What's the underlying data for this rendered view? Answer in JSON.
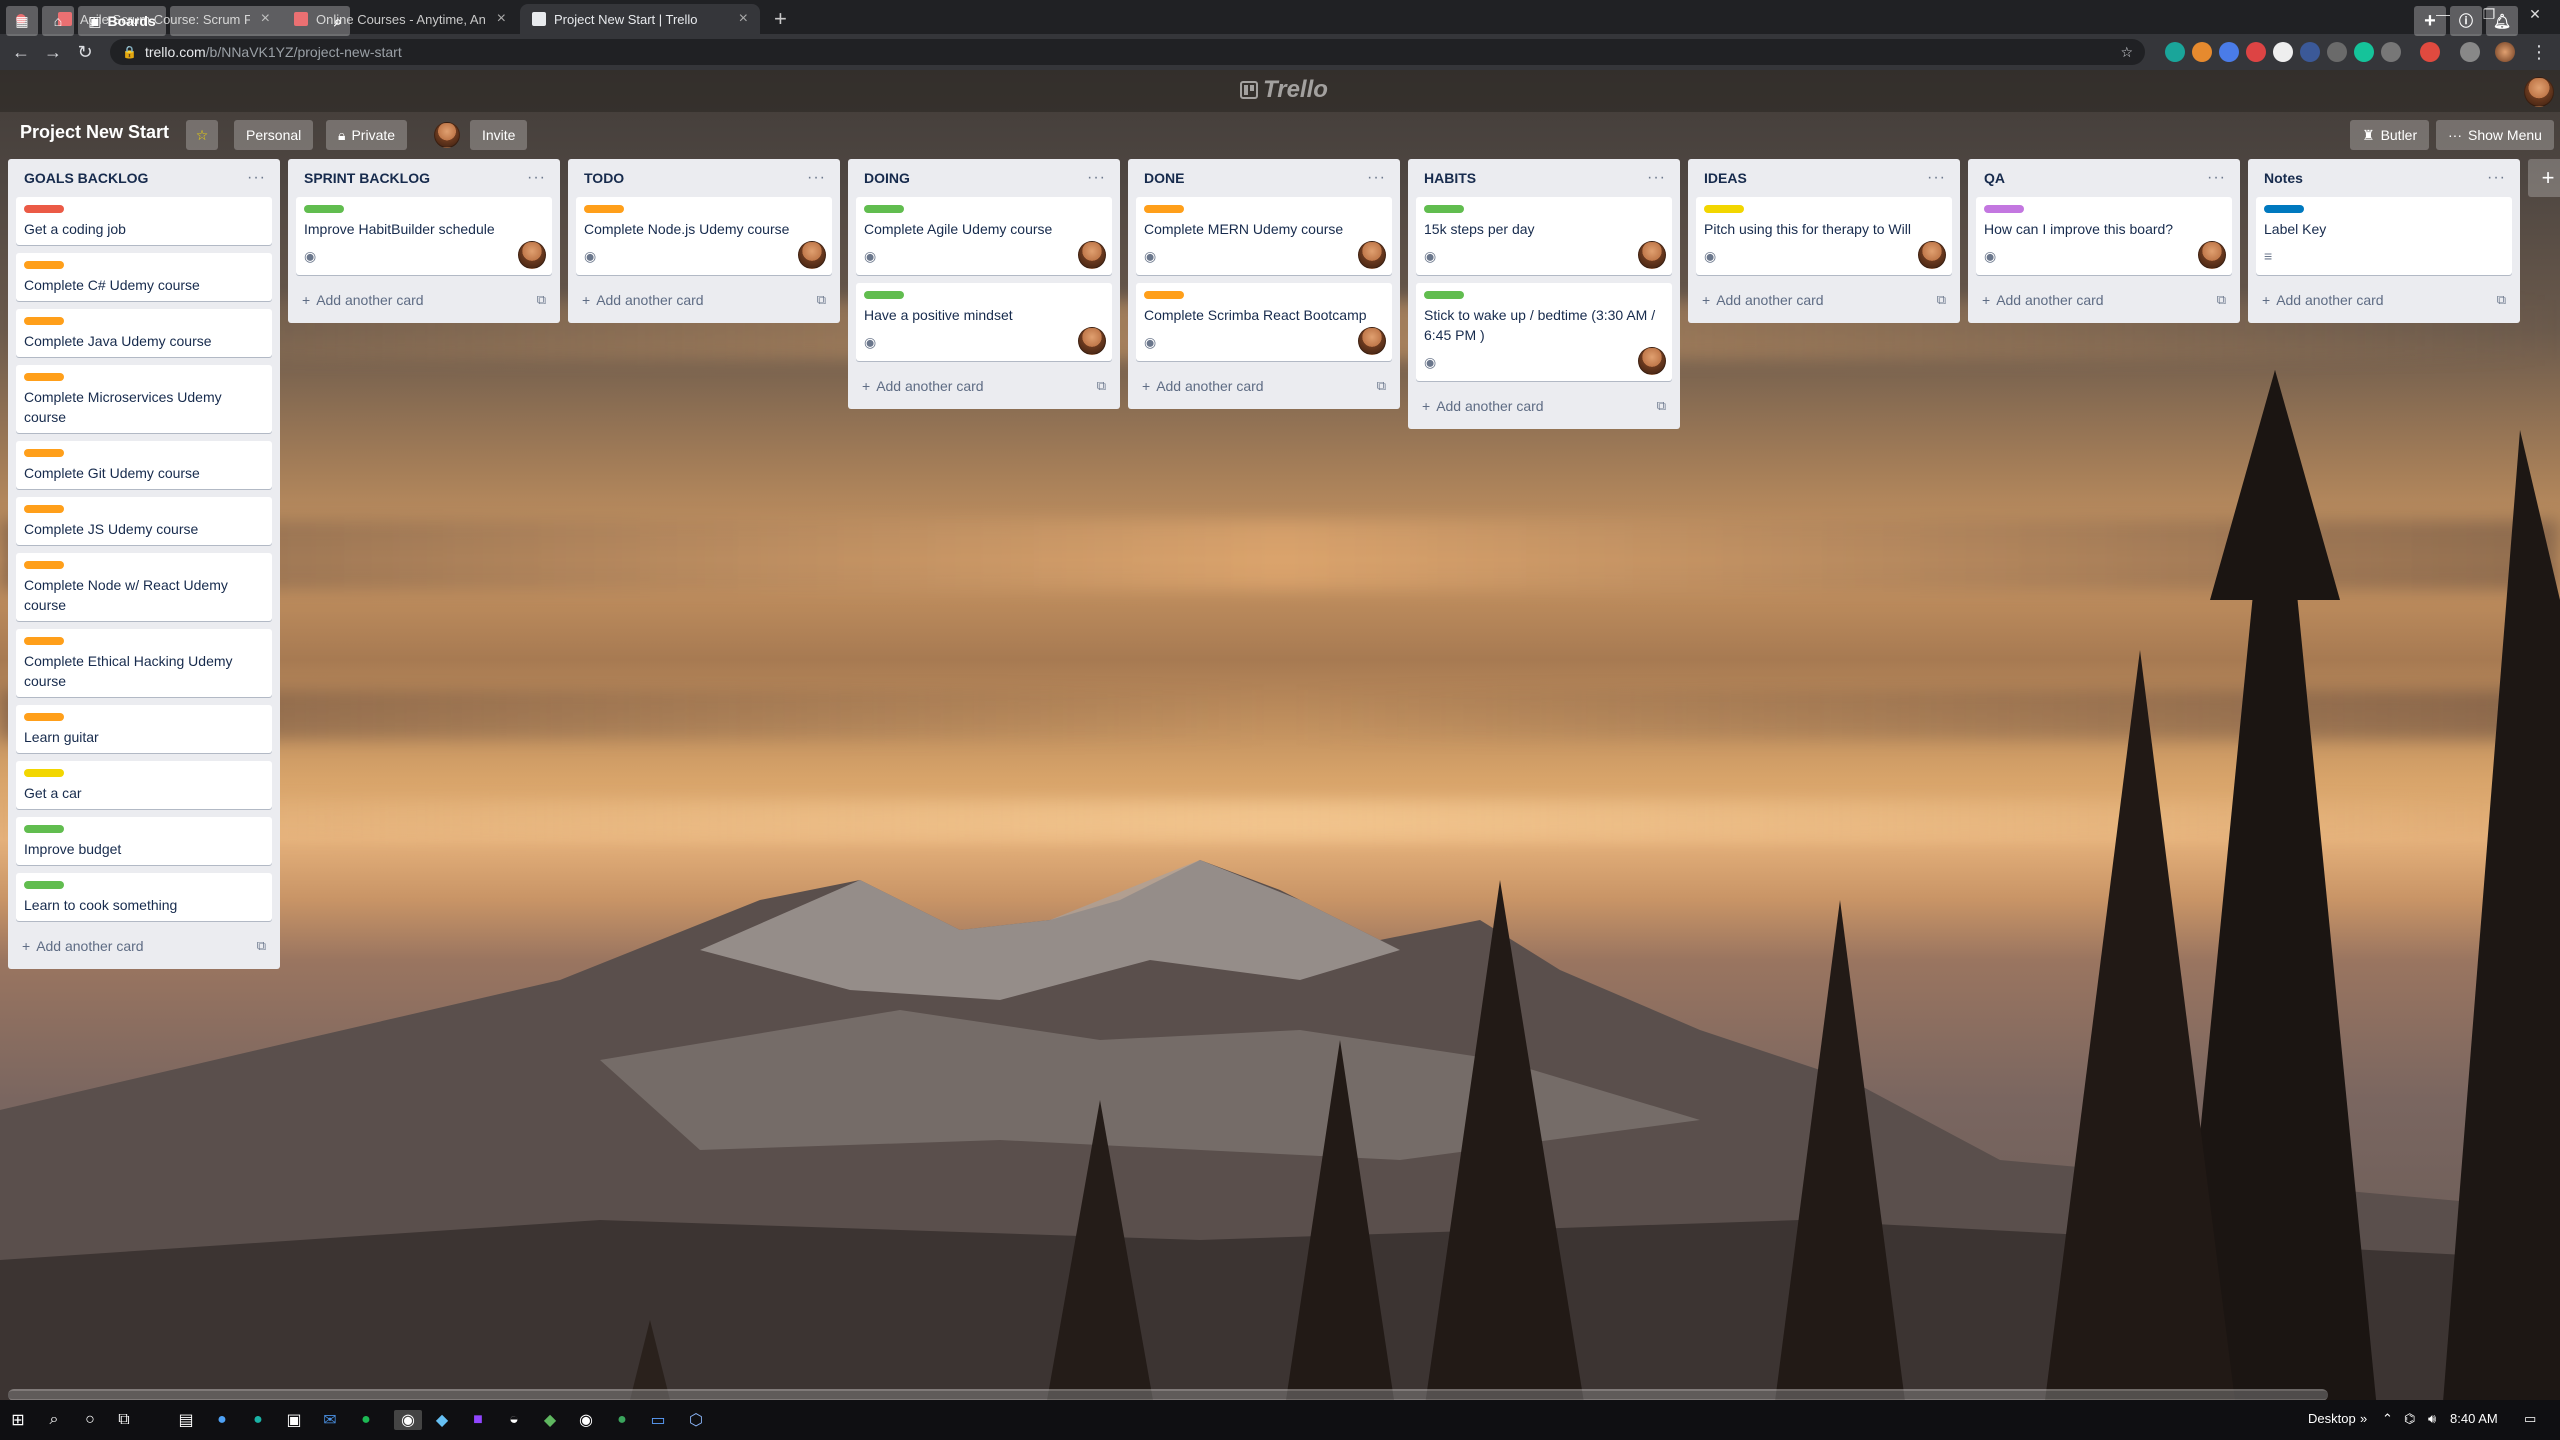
{
  "browser": {
    "tabs": [
      {
        "title": "Agile Scrum Course: Scrum Fund",
        "favicon_color": "#e4393c"
      },
      {
        "title": "Online Courses - Anytime, Anyw",
        "favicon_color": "#e4393c"
      },
      {
        "title": "Project New Start | Trello",
        "favicon_color": "#e8eaed"
      }
    ],
    "url_domain": "trello.com",
    "url_path": "/b/NNaVK1YZ/project-new-start"
  },
  "header": {
    "boards_label": "Boards",
    "logo_text": "Trello"
  },
  "board": {
    "title": "Project New Start",
    "personal_label": "Personal",
    "private_label": "Private",
    "invite_label": "Invite",
    "butler_label": "Butler",
    "show_menu_label": "Show Menu",
    "add_card_label": "Add another card"
  },
  "lists": [
    {
      "title": "GOALS BACKLOG",
      "cards": [
        {
          "text": "Get a coding job",
          "label": "#eb5a46"
        },
        {
          "text": "Complete C# Udemy course",
          "label": "#ff9f1a"
        },
        {
          "text": "Complete Java Udemy course",
          "label": "#ff9f1a"
        },
        {
          "text": "Complete Microservices Udemy course",
          "label": "#ff9f1a"
        },
        {
          "text": "Complete Git Udemy course",
          "label": "#ff9f1a"
        },
        {
          "text": "Complete JS Udemy course",
          "label": "#ff9f1a"
        },
        {
          "text": "Complete Node w/ React Udemy course",
          "label": "#ff9f1a"
        },
        {
          "text": "Complete Ethical Hacking Udemy course",
          "label": "#ff9f1a"
        },
        {
          "text": "Learn guitar",
          "label": "#ff9f1a"
        },
        {
          "text": "Get a car",
          "label": "#f2d600"
        },
        {
          "text": "Improve budget",
          "label": "#61bd4f"
        },
        {
          "text": "Learn to cook something",
          "label": "#61bd4f"
        }
      ]
    },
    {
      "title": "SPRINT BACKLOG",
      "cards": [
        {
          "text": "Improve HabitBuilder schedule",
          "label": "#61bd4f",
          "watch": true,
          "member": true
        }
      ]
    },
    {
      "title": "TODO",
      "cards": [
        {
          "text": "Complete Node.js Udemy course",
          "label": "#ff9f1a",
          "watch": true,
          "member": true
        }
      ]
    },
    {
      "title": "DOING",
      "cards": [
        {
          "text": "Complete Agile Udemy course",
          "label": "#61bd4f",
          "watch": true,
          "member": true
        },
        {
          "text": "Have a positive mindset",
          "label": "#61bd4f",
          "watch": true,
          "member": true
        }
      ]
    },
    {
      "title": "DONE",
      "cards": [
        {
          "text": "Complete MERN Udemy course",
          "label": "#ff9f1a",
          "watch": true,
          "member": true
        },
        {
          "text": "Complete Scrimba React Bootcamp",
          "label": "#ff9f1a",
          "watch": true,
          "member": true
        }
      ]
    },
    {
      "title": "HABITS",
      "cards": [
        {
          "text": "15k steps per day",
          "label": "#61bd4f",
          "watch": true,
          "member": true
        },
        {
          "text": "Stick to wake up / bedtime (3:30 AM / 6:45 PM )",
          "label": "#61bd4f",
          "watch": true,
          "member": true
        }
      ]
    },
    {
      "title": "IDEAS",
      "cards": [
        {
          "text": "Pitch using this for therapy to Will",
          "label": "#f2d600",
          "watch": true,
          "member": true
        }
      ]
    },
    {
      "title": "QA",
      "cards": [
        {
          "text": "How can I improve this board?",
          "label": "#c377e0",
          "watch": true,
          "member": true
        }
      ]
    },
    {
      "title": "Notes",
      "cards": [
        {
          "text": "Label Key",
          "label": "#0079bf",
          "description": true
        }
      ]
    }
  ],
  "taskbar": {
    "desktop_label": "Desktop",
    "time": "8:40 AM"
  }
}
